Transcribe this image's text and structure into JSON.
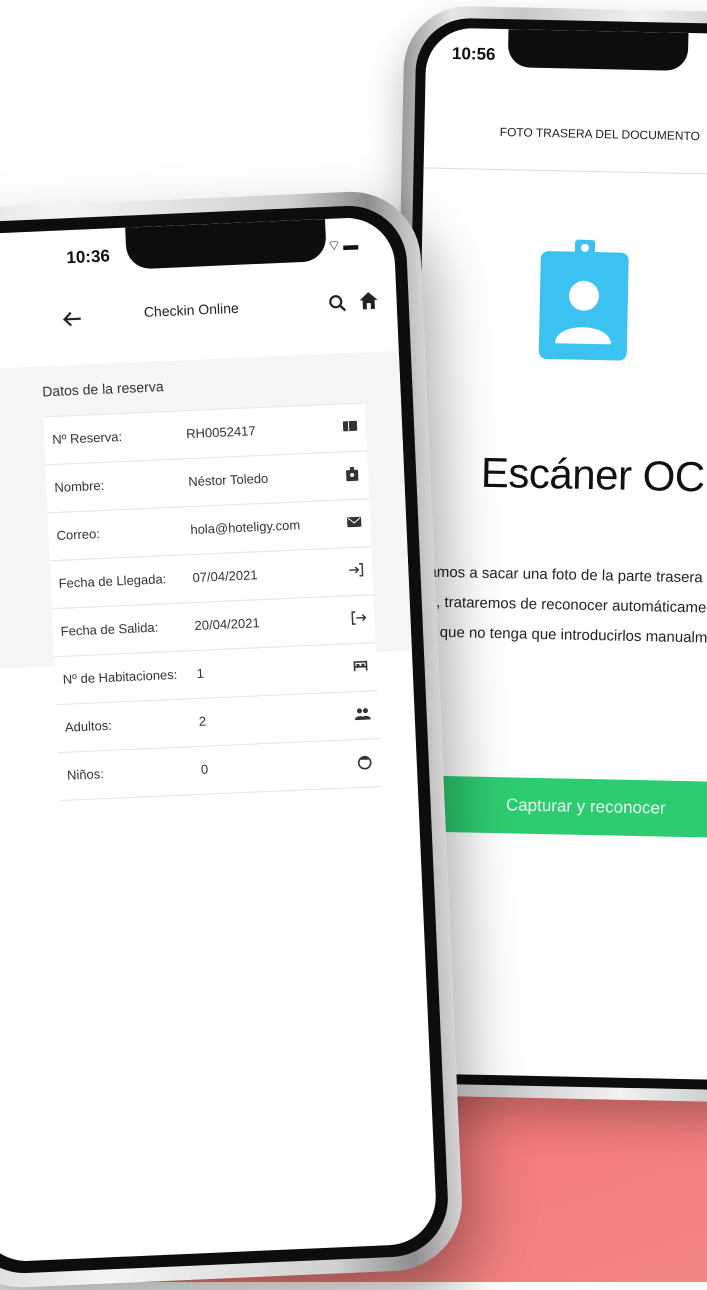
{
  "colors": {
    "background_accent": "#f04646",
    "button_green": "#2ecc71",
    "badge_blue": "#3cc2f0"
  },
  "back_phone": {
    "status_time": "10:56",
    "header_title": "FOTO TRASERA DEL DOCUMENTO",
    "badge_icon": "id-badge-icon",
    "title": "Escáner OCR",
    "description_lines": [
      "ora vamos a sacar una foto de la parte trasera del",
      "mento, trataremos de reconocer automáticamente los",
      "s para que no tenga que introducirlos manualmente."
    ],
    "button_label": "Capturar y reconocer"
  },
  "front_phone": {
    "status_time": "10:36",
    "appbar": {
      "title": "Checkin Online",
      "back_icon": "arrow-left-icon",
      "search_icon": "search-icon",
      "home_icon": "home-icon"
    },
    "section_title": "Datos de la reserva",
    "rows": [
      {
        "label": "Nº Reserva:",
        "value": "RH0052417",
        "icon": "ticket-icon"
      },
      {
        "label": "Nombre:",
        "value": "Néstor Toledo",
        "icon": "person-badge-icon"
      },
      {
        "label": "Correo:",
        "value": "hola@hoteligy.com",
        "icon": "mail-icon"
      },
      {
        "label": "Fecha de Llegada:",
        "value": "07/04/2021",
        "icon": "login-icon"
      },
      {
        "label": "Fecha de Salida:",
        "value": "20/04/2021",
        "icon": "logout-icon"
      },
      {
        "label": "Nº de Habitaciones:",
        "value": "1",
        "icon": "bed-icon"
      },
      {
        "label": "Adultos:",
        "value": "2",
        "icon": "people-icon"
      },
      {
        "label": "Niños:",
        "value": "0",
        "icon": "child-icon"
      }
    ]
  }
}
